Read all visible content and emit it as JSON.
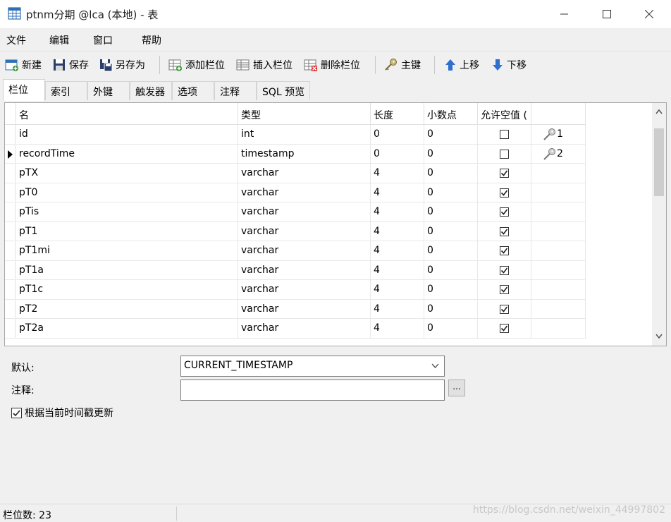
{
  "window": {
    "title": "ptnm分期 @lca (本地) - 表"
  },
  "menu": [
    "文件",
    "编辑",
    "窗口",
    "帮助"
  ],
  "toolbar": {
    "new_label": "新建",
    "save_label": "保存",
    "save_as_label": "另存为",
    "add_column_label": "添加栏位",
    "insert_column_label": "插入栏位",
    "delete_column_label": "删除栏位",
    "primary_key_label": "主键",
    "move_up_label": "上移",
    "move_down_label": "下移"
  },
  "tabs": [
    "栏位",
    "索引",
    "外键",
    "触发器",
    "选项",
    "注释",
    "SQL 预览"
  ],
  "grid": {
    "headers": [
      "名",
      "类型",
      "长度",
      "小数点",
      "允许空值 ("
    ],
    "rows": [
      {
        "name": "id",
        "type": "int",
        "length": "0",
        "decimal": "0",
        "nullable": false,
        "key": "1"
      },
      {
        "name": "recordTime",
        "type": "timestamp",
        "length": "0",
        "decimal": "0",
        "nullable": false,
        "key": "2"
      },
      {
        "name": "pTX",
        "type": "varchar",
        "length": "4",
        "decimal": "0",
        "nullable": true,
        "key": ""
      },
      {
        "name": "pT0",
        "type": "varchar",
        "length": "4",
        "decimal": "0",
        "nullable": true,
        "key": ""
      },
      {
        "name": "pTis",
        "type": "varchar",
        "length": "4",
        "decimal": "0",
        "nullable": true,
        "key": ""
      },
      {
        "name": "pT1",
        "type": "varchar",
        "length": "4",
        "decimal": "0",
        "nullable": true,
        "key": ""
      },
      {
        "name": "pT1mi",
        "type": "varchar",
        "length": "4",
        "decimal": "0",
        "nullable": true,
        "key": ""
      },
      {
        "name": "pT1a",
        "type": "varchar",
        "length": "4",
        "decimal": "0",
        "nullable": true,
        "key": ""
      },
      {
        "name": "pT1c",
        "type": "varchar",
        "length": "4",
        "decimal": "0",
        "nullable": true,
        "key": ""
      },
      {
        "name": "pT2",
        "type": "varchar",
        "length": "4",
        "decimal": "0",
        "nullable": true,
        "key": ""
      },
      {
        "name": "pT2a",
        "type": "varchar",
        "length": "4",
        "decimal": "0",
        "nullable": true,
        "key": ""
      }
    ],
    "selected_row": 1
  },
  "properties": {
    "default_label": "默认:",
    "default_value": "CURRENT_TIMESTAMP",
    "comment_label": "注释:",
    "comment_value": "",
    "ellipsis_label": "...",
    "update_checkbox_label": "根据当前时间戳更新",
    "update_checked": true
  },
  "status": {
    "column_count": "栏位数: 23",
    "watermark": "https://blog.csdn.net/weixin_44997802"
  }
}
